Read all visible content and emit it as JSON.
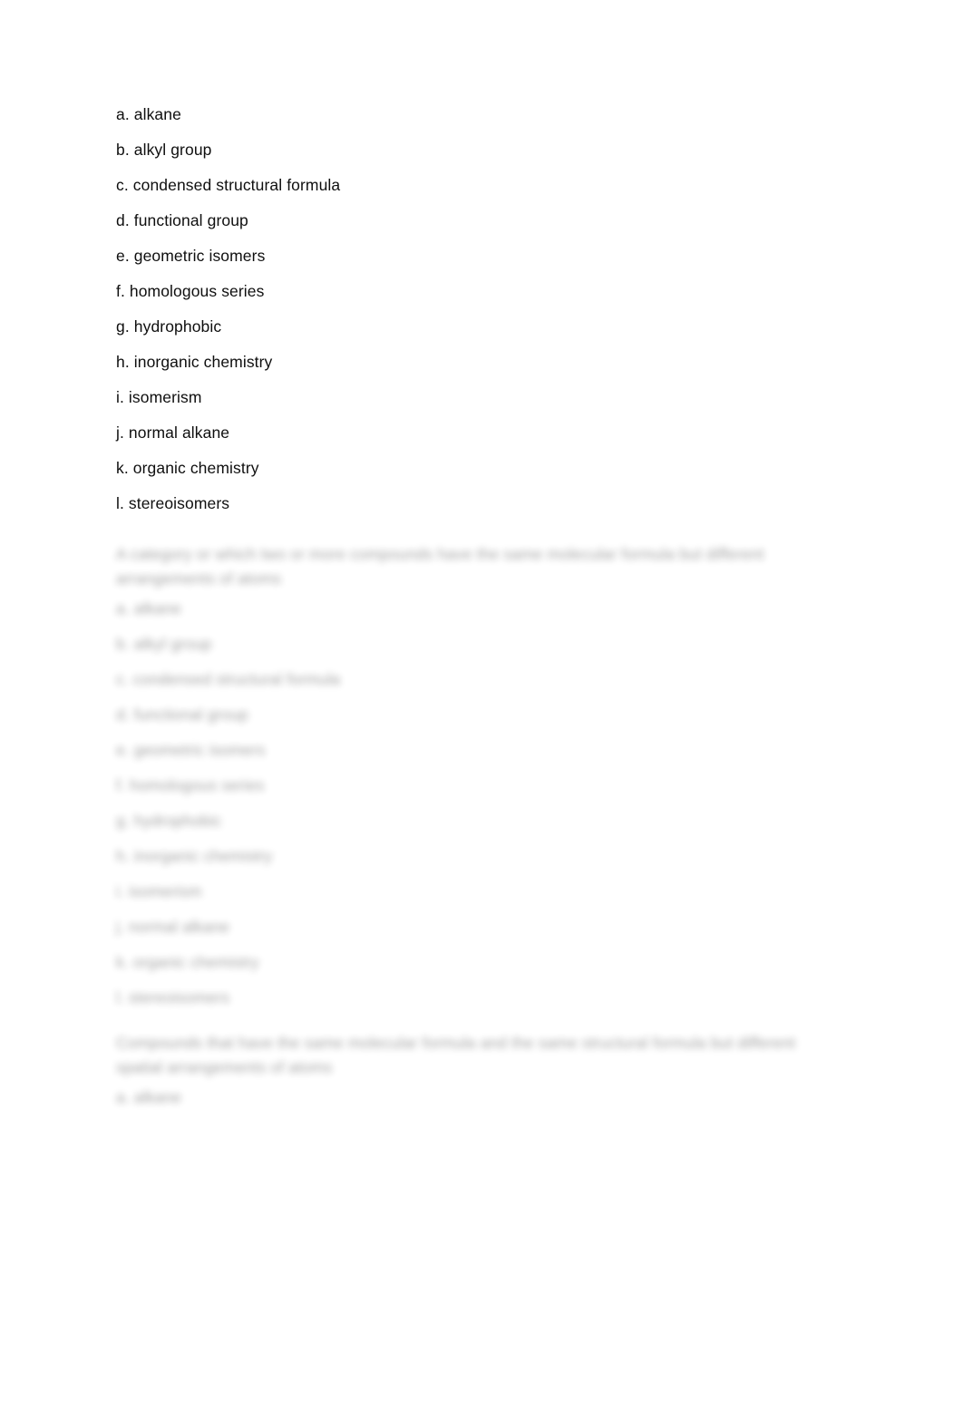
{
  "document": {
    "background_color": "#ffffff",
    "text_color": "#0f0f0f",
    "terms": [
      {
        "label": "a. alkane"
      },
      {
        "label": "b. alkyl group"
      },
      {
        "label": "c. condensed structural formula"
      },
      {
        "label": "d. functional group"
      },
      {
        "label": "e. geometric isomers"
      },
      {
        "label": "f. homologous series"
      },
      {
        "label": "g. hydrophobic"
      },
      {
        "label": "h. inorganic chemistry"
      },
      {
        "label": "i. isomerism"
      },
      {
        "label": "j. normal alkane"
      },
      {
        "label": "k. organic chemistry"
      },
      {
        "label": "l. stereoisomers"
      }
    ],
    "obscured_section": {
      "note": "blurred / illegible region",
      "paragraph_1": "A category or which two or more compounds have the same molecular formula but different arrangements of atoms",
      "terms": [
        {
          "label": "a. alkane"
        },
        {
          "label": "b. alkyl group"
        },
        {
          "label": "c. condensed structural formula"
        },
        {
          "label": "d. functional group"
        },
        {
          "label": "e. geometric isomers"
        },
        {
          "label": "f. homologous series"
        },
        {
          "label": "g. hydrophobic"
        },
        {
          "label": "h. inorganic chemistry"
        },
        {
          "label": "i. isomerism"
        },
        {
          "label": "j. normal alkane"
        },
        {
          "label": "k. organic chemistry"
        },
        {
          "label": "l. stereoisomers"
        }
      ],
      "paragraph_2": "Compounds that have the same molecular formula and the same structural formula but different spatial arrangements of atoms",
      "trailing_item": "a. alkane"
    }
  }
}
